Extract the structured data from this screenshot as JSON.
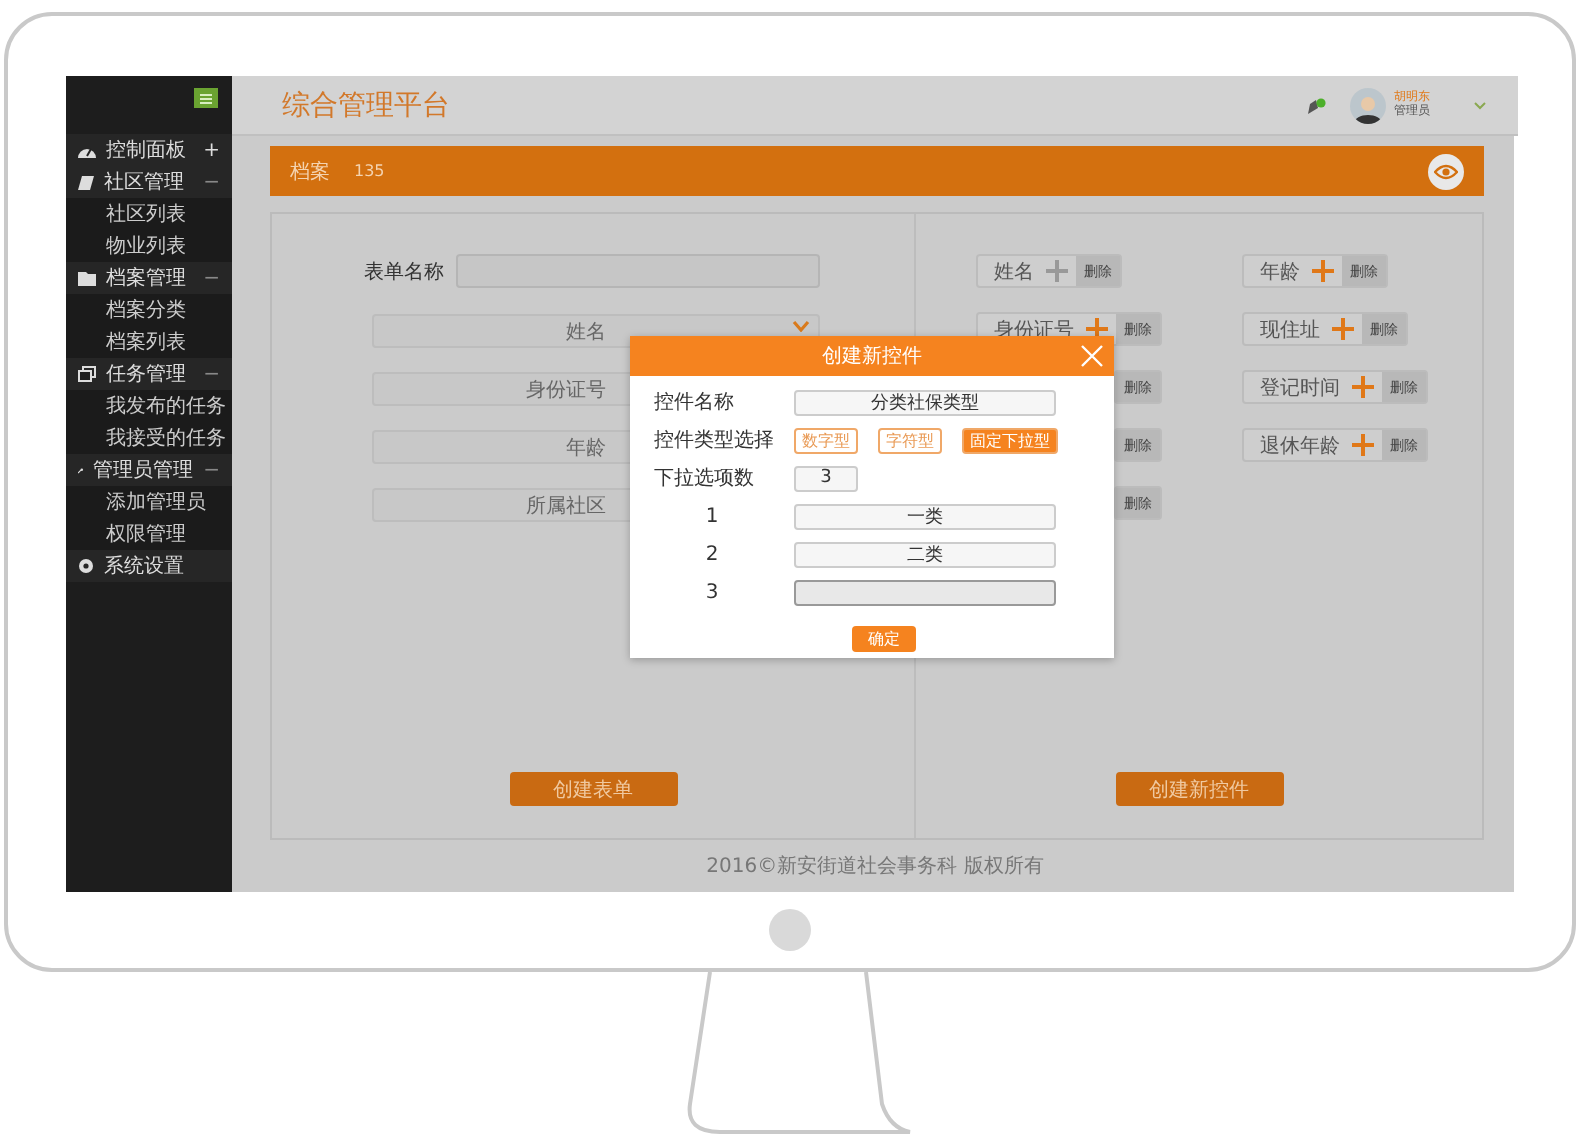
{
  "app": {
    "title": "综合管理平台"
  },
  "user": {
    "name": "胡明东",
    "role": "管理员"
  },
  "sidebar": {
    "items": [
      {
        "label": "控制面板",
        "expander": "+",
        "expanded": false
      },
      {
        "label": "社区管理",
        "expander": "−",
        "expanded": true,
        "children": [
          {
            "label": "社区列表"
          },
          {
            "label": "物业列表"
          }
        ]
      },
      {
        "label": "档案管理",
        "expander": "−",
        "expanded": true,
        "children": [
          {
            "label": "档案分类"
          },
          {
            "label": "档案列表"
          }
        ]
      },
      {
        "label": "任务管理",
        "expander": "−",
        "expanded": true,
        "children": [
          {
            "label": "我发布的任务"
          },
          {
            "label": "我接受的任务"
          }
        ]
      },
      {
        "label": "管理员管理",
        "expander": "−",
        "expanded": true,
        "children": [
          {
            "label": "添加管理员"
          },
          {
            "label": "权限管理"
          }
        ]
      },
      {
        "label": "系统设置"
      }
    ]
  },
  "section_bar": {
    "title": "档案",
    "count": "135"
  },
  "form": {
    "name_label": "表单名称",
    "fields": [
      {
        "label": "姓名",
        "dropdown": true
      },
      {
        "label": "身份证号"
      },
      {
        "label": "年龄"
      },
      {
        "label": "所属社区"
      }
    ],
    "submit": "创建表单"
  },
  "controls": {
    "columns": [
      [
        {
          "label": "姓名",
          "disabled": true,
          "delete": "删除"
        },
        {
          "label": "身份证号",
          "disabled": false,
          "delete": "删除"
        },
        {
          "delete": "删除"
        },
        {
          "delete": "删除"
        },
        {
          "delete": "删除"
        }
      ],
      [
        {
          "label": "年龄",
          "disabled": false,
          "delete": "删除"
        },
        {
          "label": "现住址",
          "disabled": false,
          "delete": "删除"
        },
        {
          "label": "登记时间",
          "disabled": false,
          "delete": "删除"
        },
        {
          "label": "退休年龄",
          "disabled": false,
          "delete": "删除"
        }
      ]
    ],
    "submit": "创建新控件"
  },
  "footer": "2016©新安街道社会事务科 版权所有",
  "dialog": {
    "title": "创建新控件",
    "name_label": "控件名称",
    "name_value": "分类社保类型",
    "type_label": "控件类型选择",
    "types": [
      {
        "label": "数字型",
        "selected": false
      },
      {
        "label": "字符型",
        "selected": false
      },
      {
        "label": "固定下拉型",
        "selected": true
      }
    ],
    "count_label": "下拉选项数",
    "count_value": "3",
    "options": [
      {
        "index": "1",
        "value": "一类"
      },
      {
        "index": "2",
        "value": "二类"
      },
      {
        "index": "3",
        "focused": true
      }
    ],
    "confirm": "确定"
  }
}
